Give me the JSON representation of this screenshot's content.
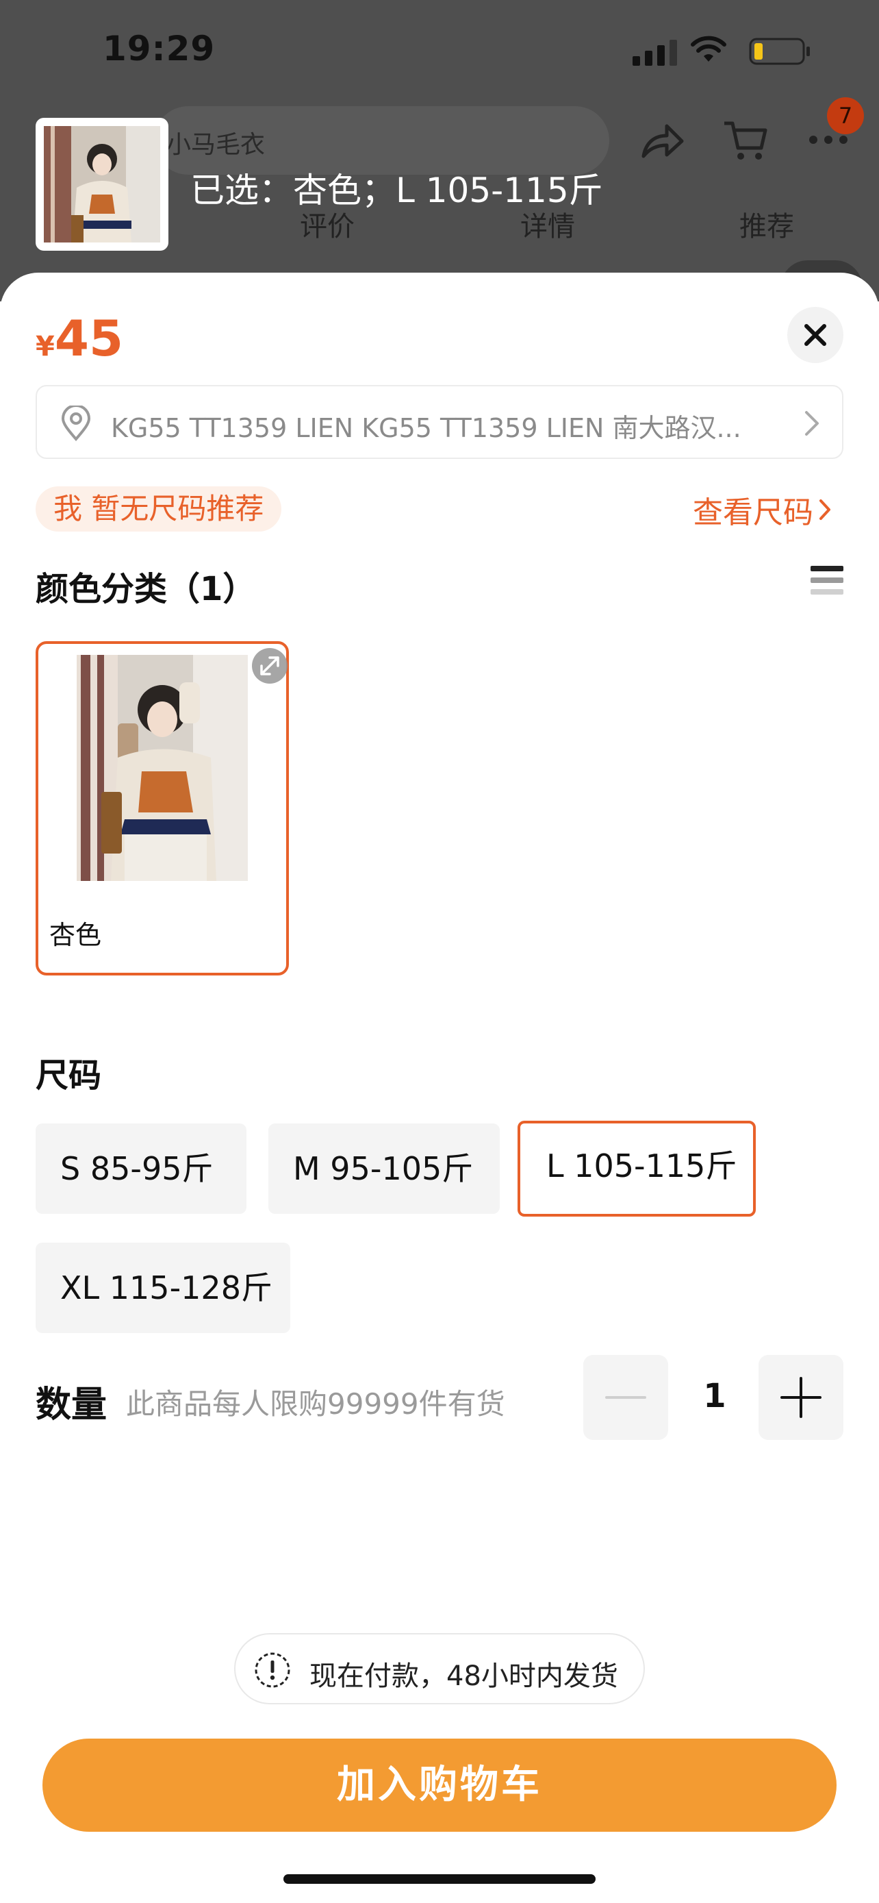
{
  "status_bar": {
    "time": "19:29"
  },
  "background": {
    "search_text": "小马毛衣",
    "cart_badge": "7",
    "tabs": [
      "评价",
      "详情",
      "推荐"
    ]
  },
  "sheet": {
    "selected_summary": "已选：杏色；L 105-115斤",
    "price": {
      "currency": "¥",
      "value": "45"
    },
    "address": "KG55 TT1359 LIEN KG55 TT1359 LIEN 南大路汉...",
    "size_recommend": "我 暂无尺码推荐",
    "see_size": "查看尺码",
    "color_section_title": "颜色分类（1）",
    "colors": [
      {
        "label": "杏色",
        "selected": true
      }
    ],
    "size_section_title": "尺码",
    "sizes": [
      {
        "label": "S 85-95斤",
        "selected": false
      },
      {
        "label": "M 95-105斤",
        "selected": false
      },
      {
        "label": "L 105-115斤",
        "selected": true
      },
      {
        "label": "XL 115-128斤",
        "selected": false
      }
    ],
    "quantity_label": "数量",
    "quantity_note": "此商品每人限购99999件有货",
    "quantity_value": "1",
    "shipping_note": "现在付款，48小时内发货",
    "add_to_cart": "加入购物车"
  },
  "colors": {
    "accent": "#e8612a",
    "cart_button": "#f39b32"
  }
}
